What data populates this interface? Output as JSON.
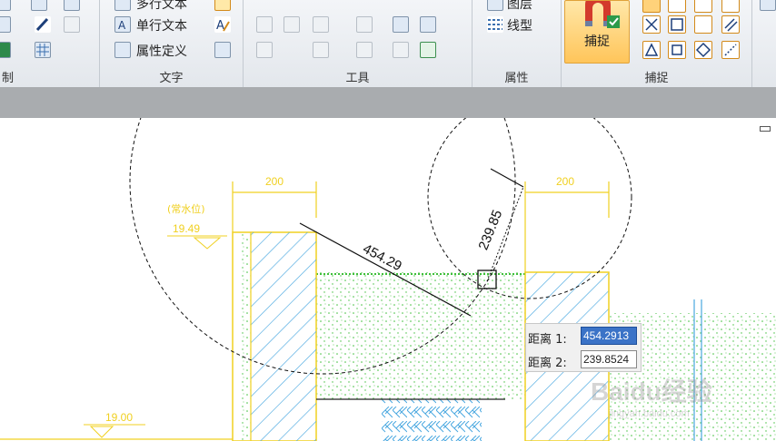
{
  "ribbon": {
    "groups": [
      {
        "label": "制"
      },
      {
        "label": "文字"
      },
      {
        "label": "工具"
      },
      {
        "label": "属性"
      },
      {
        "label": "捕捉"
      }
    ],
    "text_group": {
      "item1": "多行文本",
      "item2": "单行文本",
      "item3": "属性定义"
    },
    "attr_group": {
      "item1": "图层",
      "item2": "线型"
    },
    "snap_button_label": "捕捉"
  },
  "drawing": {
    "dim_200_left": "200",
    "dim_200_right": "200",
    "dim_454": "454.29",
    "dim_239": "239.85",
    "label_water": "(常水位)",
    "elev_1949": "19.49",
    "elev_1900": "19.00"
  },
  "dim_input": {
    "label1": "距离 1:",
    "value1": "454.2913",
    "label2": "距离 2:",
    "value2": "239.8524"
  },
  "watermark": {
    "text": "Baidu经验",
    "sub": "jingyan.baidu.com"
  }
}
